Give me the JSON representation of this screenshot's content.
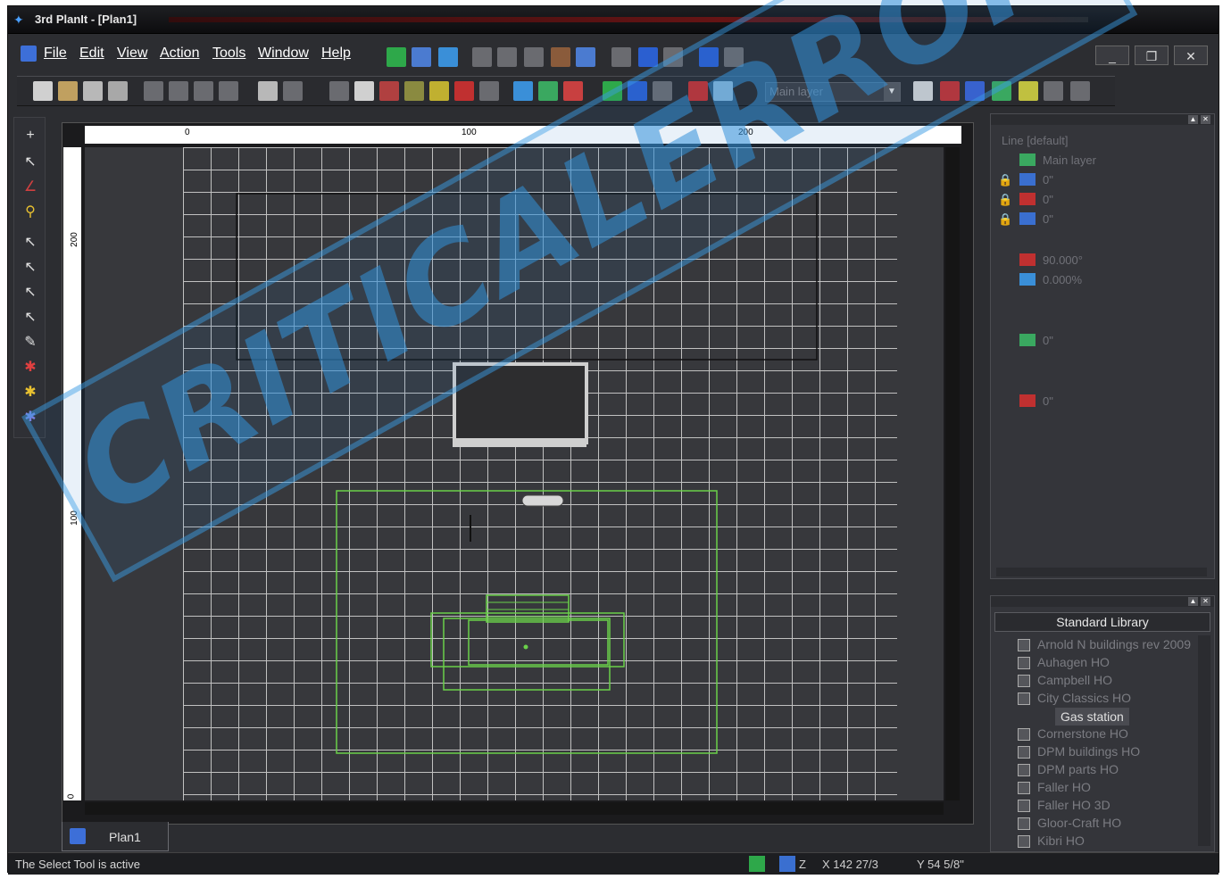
{
  "window": {
    "title": "3rd PlanIt - [Plan1]"
  },
  "menu": {
    "items": [
      "File",
      "Edit",
      "View",
      "Action",
      "Tools",
      "Window",
      "Help"
    ]
  },
  "window_controls": {
    "minimize": "_",
    "restore": "❐",
    "close": "✕"
  },
  "toolbar": {
    "layer_select_value": "Main layer"
  },
  "rulers": {
    "h_labels": [
      "0",
      "100",
      "200"
    ],
    "v_labels": [
      "200",
      "100",
      "0"
    ]
  },
  "properties_panel": {
    "header": "Line [default]",
    "layer": "Main layer",
    "values": [
      "0\"",
      "0\"",
      "0\"",
      "90.000°",
      "0.000%",
      "0\"",
      "0\""
    ]
  },
  "library_panel": {
    "title": "Standard Library",
    "items": [
      "Arnold N buildings rev 2009",
      "Auhagen HO",
      "Campbell HO",
      "City Classics HO",
      "Gas station",
      "Cornerstone HO",
      "DPM buildings HO",
      "DPM parts HO",
      "Faller HO",
      "Faller HO 3D",
      "Gloor-Craft HO",
      "Kibri HO"
    ],
    "selected": "Gas station"
  },
  "document_tab": {
    "label": "Plan1"
  },
  "status": {
    "message": "The Select Tool is active",
    "z_label": "Z",
    "x_coord": "X 142 27/3",
    "y_coord": "Y 54 5/8\""
  },
  "watermark": {
    "text": "CRITICALERROR"
  }
}
